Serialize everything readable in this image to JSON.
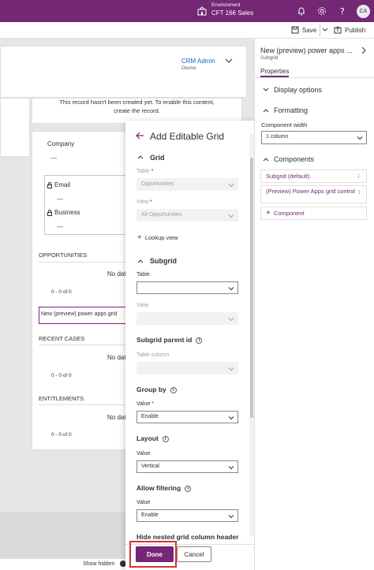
{
  "topbar": {
    "environment_label": "Environment",
    "environment_name": "CFT 166 Sales",
    "avatar_initials": "CA"
  },
  "command_bar": {
    "save_label": "Save",
    "publish_label": "Publish"
  },
  "form": {
    "owner_name": "CRM Admin",
    "owner_label": "Owner",
    "notice_line1": "This record hasn't been created yet. To enable this content,",
    "notice_line2": "create the record.",
    "company_label": "Company",
    "company_value": "---",
    "email_label": "Email",
    "email_value": "---",
    "business_label": "Business",
    "business_value": "---",
    "opportunities_label": "OPPORTUNITIES",
    "no_data_1": "No dat",
    "paging_1": "0 - 0 of 0",
    "subgrid_selected": "New (preview) power apps grid",
    "recent_cases_label": "RECENT CASES",
    "no_data_2": "No dat",
    "paging_2": "0 - 0 of 0",
    "entitlements_label": "ENTITLEMENTS",
    "no_data_3": "No dat",
    "paging_3": "0 - 0 of 0",
    "show_hidden_label": "Show hidden"
  },
  "modal": {
    "title": "Add Editable Grid",
    "grid_section": "Grid",
    "table_label": "Table",
    "table_value": "Opportunities",
    "view_label": "View",
    "view_value": "All Opportunities",
    "lookup_view_label": "Lookup view",
    "subgrid_section": "Subgrid",
    "subgrid_table_label": "Table",
    "subgrid_table_value": "",
    "subgrid_view_label": "View",
    "subgrid_view_value": "",
    "subgrid_parent_label": "Subgrid parent id",
    "table_column_label": "Table column",
    "table_column_value": "",
    "group_by_label": "Group by",
    "group_by_value_label": "Value",
    "group_by_value": "Enable",
    "layout_label": "Layout",
    "layout_value_label": "Value",
    "layout_value": "Vertical",
    "allow_filtering_label": "Allow filtering",
    "allow_filtering_value_label": "Value",
    "allow_filtering_value": "Enable",
    "hide_nested_label": "Hide nested grid column header",
    "done_label": "Done",
    "cancel_label": "Cancel"
  },
  "properties_pane": {
    "title": "New (preview) power apps ...",
    "subtitle": "Subgrid",
    "tab_properties": "Properties",
    "display_options": "Display options",
    "formatting": "Formatting",
    "component_width_label": "Component width",
    "component_width_value": "1 column",
    "components": "Components",
    "component_items": [
      "Subgrid (default)",
      "(Preview) Power Apps grid control"
    ],
    "add_component_label": "Component"
  },
  "colors": {
    "brand": "#742774",
    "accent_blue": "#0f6cbd",
    "highlight_red": "#d13438"
  }
}
